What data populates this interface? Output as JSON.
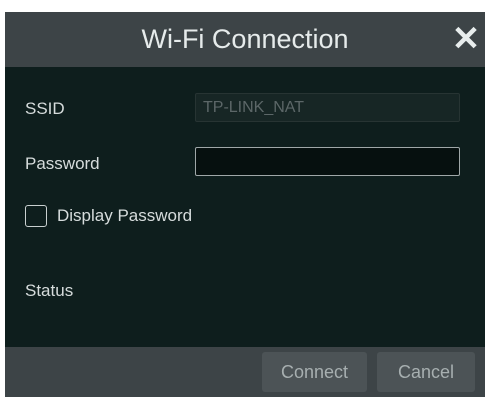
{
  "dialog": {
    "title": "Wi-Fi Connection",
    "close_glyph": "✕",
    "close_icon": "close-icon"
  },
  "form": {
    "ssid_label": "SSID",
    "ssid_value": "TP-LINK_NAT",
    "password_label": "Password",
    "password_value": "",
    "display_password_label": "Display Password",
    "display_password_checked": false,
    "status_label": "Status",
    "status_value": ""
  },
  "footer": {
    "connect_label": "Connect",
    "cancel_label": "Cancel"
  },
  "colors": {
    "background": "#0e1e1d",
    "titlebar": "#3d4447",
    "button": "#4c5356",
    "text": "#d6dcdc"
  }
}
